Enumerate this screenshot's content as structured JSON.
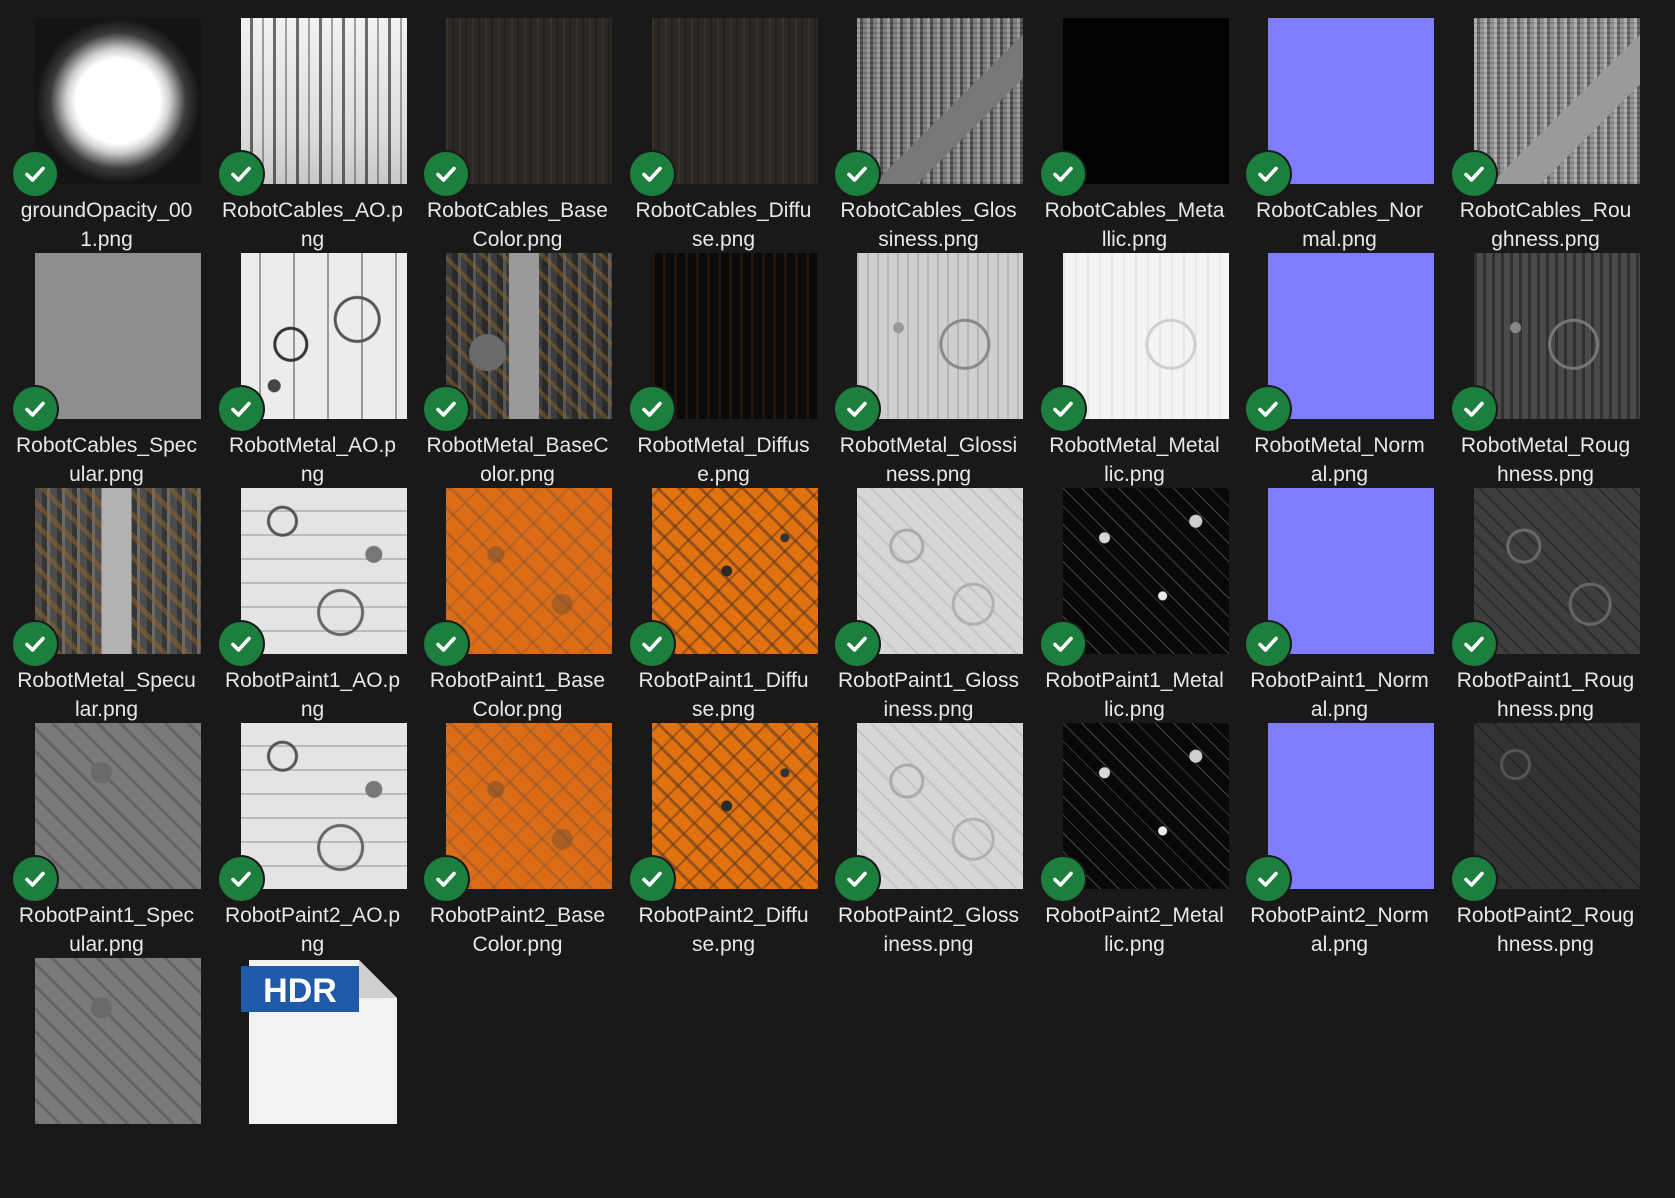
{
  "files": [
    {
      "name": "groundOpacity_001.png",
      "line1": "groundOpacity_00",
      "line2": "1.png",
      "thumb": "t-opacity",
      "synced": true
    },
    {
      "name": "RobotCables_AO.png",
      "line1": "RobotCables_AO.p",
      "line2": "ng",
      "thumb": "t-ao-cables",
      "synced": true
    },
    {
      "name": "RobotCables_BaseColor.png",
      "line1": "RobotCables_Base",
      "line2": "Color.png",
      "thumb": "t-dark-wood",
      "synced": true
    },
    {
      "name": "RobotCables_Diffuse.png",
      "line1": "RobotCables_Diffu",
      "line2": "se.png",
      "thumb": "t-dark-wood",
      "synced": true
    },
    {
      "name": "RobotCables_Glossiness.png",
      "line1": "RobotCables_Glos",
      "line2": "siness.png",
      "thumb": "t-gloss-cables",
      "synced": true
    },
    {
      "name": "RobotCables_Metallic.png",
      "line1": "RobotCables_Meta",
      "line2": "llic.png",
      "thumb": "t-black",
      "synced": true
    },
    {
      "name": "RobotCables_Normal.png",
      "line1": "RobotCables_Nor",
      "line2": "mal.png",
      "thumb": "t-normal",
      "synced": true
    },
    {
      "name": "RobotCables_Roughness.png",
      "line1": "RobotCables_Rou",
      "line2": "ghness.png",
      "thumb": "t-rough-cables",
      "synced": true
    },
    {
      "name": "RobotCables_Specular.png",
      "line1": "RobotCables_Spec",
      "line2": "ular.png",
      "thumb": "t-grey",
      "synced": true
    },
    {
      "name": "RobotMetal_AO.png",
      "line1": "RobotMetal_AO.p",
      "line2": "ng",
      "thumb": "t-ao-light",
      "synced": true
    },
    {
      "name": "RobotMetal_BaseColor.png",
      "line1": "RobotMetal_BaseC",
      "line2": "olor.png",
      "thumb": "t-metal-base",
      "synced": true
    },
    {
      "name": "RobotMetal_Diffuse.png",
      "line1": "RobotMetal_Diffus",
      "line2": "e.png",
      "thumb": "t-metal-diffuse",
      "synced": true
    },
    {
      "name": "RobotMetal_Glossiness.png",
      "line1": "RobotMetal_Glossi",
      "line2": "ness.png",
      "thumb": "t-metal-gloss",
      "synced": true
    },
    {
      "name": "RobotMetal_Metallic.png",
      "line1": "RobotMetal_Metal",
      "line2": "lic.png",
      "thumb": "t-metal-metallic",
      "synced": true
    },
    {
      "name": "RobotMetal_Normal.png",
      "line1": "RobotMetal_Norm",
      "line2": "al.png",
      "thumb": "t-normal",
      "synced": true
    },
    {
      "name": "RobotMetal_Roughness.png",
      "line1": "RobotMetal_Roug",
      "line2": "hness.png",
      "thumb": "t-metal-rough",
      "synced": true
    },
    {
      "name": "RobotMetal_Specular.png",
      "line1": "RobotMetal_Specu",
      "line2": "lar.png",
      "thumb": "t-metal-spec",
      "synced": true
    },
    {
      "name": "RobotPaint1_AO.png",
      "line1": "RobotPaint1_AO.p",
      "line2": "ng",
      "thumb": "t-paint-ao",
      "synced": true
    },
    {
      "name": "RobotPaint1_BaseColor.png",
      "line1": "RobotPaint1_Base",
      "line2": "Color.png",
      "thumb": "t-orange",
      "synced": true
    },
    {
      "name": "RobotPaint1_Diffuse.png",
      "line1": "RobotPaint1_Diffu",
      "line2": "se.png",
      "thumb": "t-orange-diffuse",
      "synced": true
    },
    {
      "name": "RobotPaint1_Glossiness.png",
      "line1": "RobotPaint1_Gloss",
      "line2": "iness.png",
      "thumb": "t-paint-gloss",
      "synced": true
    },
    {
      "name": "RobotPaint1_Metallic.png",
      "line1": "RobotPaint1_Metal",
      "line2": "lic.png",
      "thumb": "t-paint-metallic",
      "synced": true
    },
    {
      "name": "RobotPaint1_Normal.png",
      "line1": "RobotPaint1_Norm",
      "line2": "al.png",
      "thumb": "t-normal",
      "synced": true
    },
    {
      "name": "RobotPaint1_Roughness.png",
      "line1": "RobotPaint1_Roug",
      "line2": "hness.png",
      "thumb": "t-paint-rough",
      "synced": true
    },
    {
      "name": "RobotPaint1_Specular.png",
      "line1": "RobotPaint1_Spec",
      "line2": "ular.png",
      "thumb": "t-paint-spec",
      "synced": true
    },
    {
      "name": "RobotPaint2_AO.png",
      "line1": "RobotPaint2_AO.p",
      "line2": "ng",
      "thumb": "t-paint-ao",
      "synced": true
    },
    {
      "name": "RobotPaint2_BaseColor.png",
      "line1": "RobotPaint2_Base",
      "line2": "Color.png",
      "thumb": "t-orange",
      "synced": true
    },
    {
      "name": "RobotPaint2_Diffuse.png",
      "line1": "RobotPaint2_Diffu",
      "line2": "se.png",
      "thumb": "t-orange-diffuse",
      "synced": true
    },
    {
      "name": "RobotPaint2_Glossiness.png",
      "line1": "RobotPaint2_Gloss",
      "line2": "iness.png",
      "thumb": "t-paint-gloss",
      "synced": true
    },
    {
      "name": "RobotPaint2_Metallic.png",
      "line1": "RobotPaint2_Metal",
      "line2": "lic.png",
      "thumb": "t-paint-metallic",
      "synced": true
    },
    {
      "name": "RobotPaint2_Normal.png",
      "line1": "RobotPaint2_Norm",
      "line2": "al.png",
      "thumb": "t-normal",
      "synced": true
    },
    {
      "name": "RobotPaint2_Roughness.png",
      "line1": "RobotPaint2_Roug",
      "line2": "hness.png",
      "thumb": "t-paint2-rough",
      "synced": true
    },
    {
      "name": "",
      "line1": "",
      "line2": "",
      "thumb": "t-paint-spec",
      "synced": false
    },
    {
      "name": "",
      "line1": "",
      "line2": "",
      "thumb": "t-hdr",
      "icon": "hdr-file-icon",
      "badge_text": "HDR",
      "synced": false
    }
  ],
  "colors": {
    "background": "#191919",
    "check_badge": "#1c7f3e",
    "label_text": "#e8e8e8",
    "hdr_badge": "#1e5aa8"
  }
}
